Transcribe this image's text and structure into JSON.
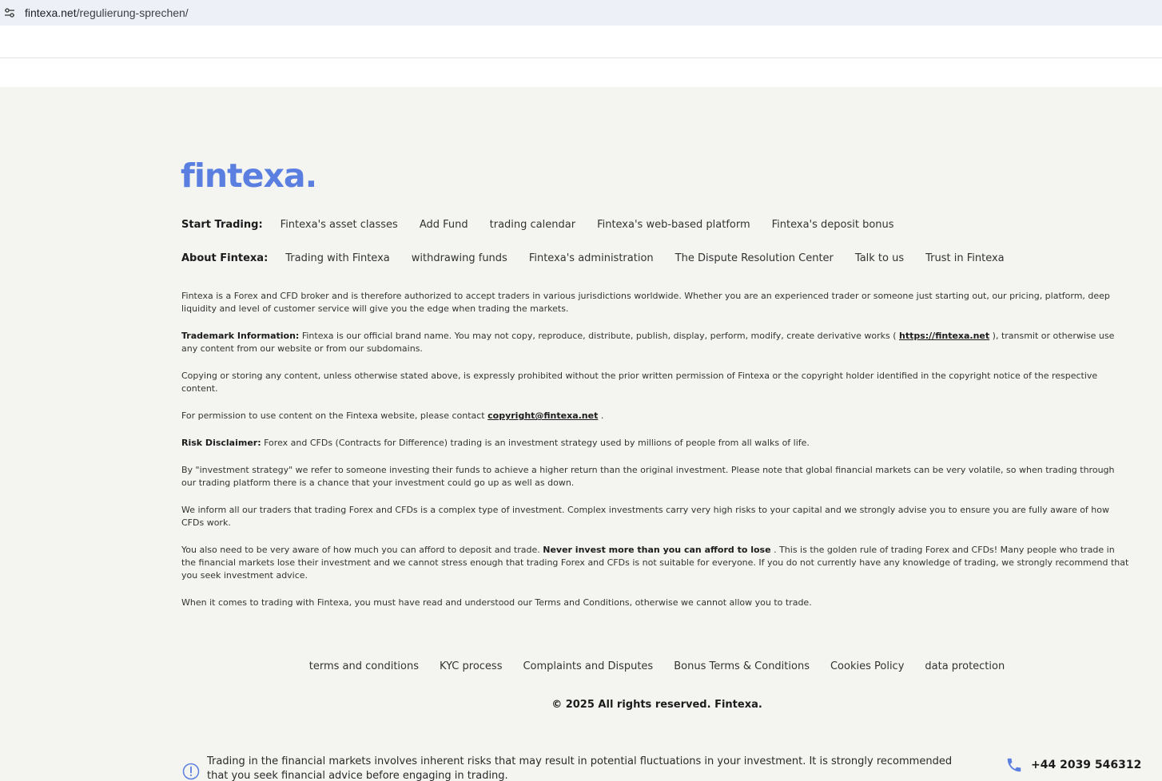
{
  "browser": {
    "url_host": "fintexa.net",
    "url_path": "/regulierung-sprechen/"
  },
  "colors": {
    "brand": "#5b7fe0",
    "footer_bg": "#f4f4f1"
  },
  "logo": {
    "text": "fintexa."
  },
  "nav": {
    "start_label": "Start Trading:",
    "start_links": [
      "Fintexa's asset classes",
      "Add Fund",
      "trading calendar",
      "Fintexa's web-based platform",
      "Fintexa's deposit bonus"
    ],
    "about_label": "About Fintexa:",
    "about_links": [
      "Trading with Fintexa",
      "withdrawing funds",
      "Fintexa's administration",
      "The Dispute Resolution Center",
      "Talk to us",
      "Trust in Fintexa"
    ]
  },
  "legal": {
    "p1": "Fintexa is a Forex and CFD broker and is therefore authorized to accept traders in various jurisdictions worldwide. Whether you are an experienced trader or someone just starting out, our pricing, platform, deep liquidity and level of customer service will give you the edge when trading the markets.",
    "p2_label": "Trademark Information:",
    "p2_a": " Fintexa is our official brand name. You may not copy, reproduce, distribute, publish, display, perform, modify, create derivative works ( ",
    "p2_link": "https://fintexa.net",
    "p2_b": " ), transmit or otherwise use any content from our website or from our subdomains.",
    "p3": "Copying or storing any content, unless otherwise stated above, is expressly prohibited without the prior written permission of Fintexa or the copyright holder identified in the copyright notice of the respective content.",
    "p4_a": "For permission to use content on the Fintexa website, please contact ",
    "p4_link": "copyright@fintexa.net",
    "p4_b": " .",
    "p5_label": "Risk Disclaimer:",
    "p5_text": " Forex and CFDs (Contracts for Difference) trading is an investment strategy used by millions of people from all walks of life.",
    "p6": "By \"investment strategy\" we refer to someone investing their funds to achieve a higher return than the original investment. Please note that global financial markets can be very volatile, so when trading through our trading platform there is a chance that your investment could go up as well as down.",
    "p7": "We inform all our traders that trading Forex and CFDs is a complex type of investment. Complex investments carry very high risks to your capital and we strongly advise you to ensure you are fully aware of how CFDs work.",
    "p8_a": "You also need to be very aware of how much you can afford to deposit and trade. ",
    "p8_bold": "Never invest more than you can afford to lose",
    "p8_b": " . This is the golden rule of trading Forex and CFDs! Many people who trade in the financial markets lose their investment and we cannot stress enough that trading Forex and CFDs is not suitable for everyone. If you do not currently have any knowledge of trading, we strongly recommend that you seek investment advice.",
    "p9": "When it comes to trading with Fintexa, you must have read and understood our Terms and Conditions, otherwise we cannot allow you to trade."
  },
  "bottom_links": [
    "terms and conditions",
    "KYC process",
    "Complaints and Disputes",
    "Bonus Terms & Conditions",
    "Cookies Policy",
    "data protection"
  ],
  "copyright": "© 2025 All rights reserved. Fintexa.",
  "risk_bar": {
    "text": "Trading in the financial markets involves inherent risks that may result in potential fluctuations in your investment. It is strongly recommended that you seek financial advice before engaging in trading.",
    "phone": "+44 2039 546312"
  }
}
